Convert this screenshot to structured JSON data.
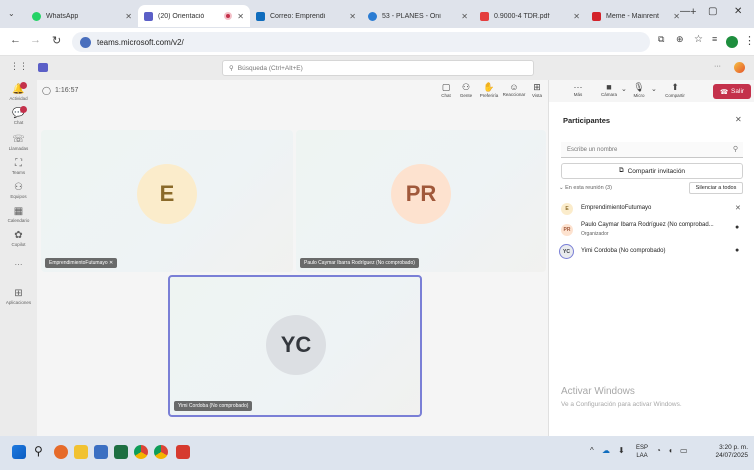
{
  "browser": {
    "tabs": [
      {
        "title": "WhatsApp",
        "color": "#25d366",
        "active": false
      },
      {
        "title": "(20) Orientació",
        "color": "#5b5fc7",
        "active": true,
        "recording": true
      },
      {
        "title": "Correo: Emprendi",
        "color": "#0f6cbd",
        "active": false
      },
      {
        "title": "53 - PLANES - Oni",
        "color": "#2b7cd3",
        "active": false
      },
      {
        "title": "0.9000-4 TDR.pdf",
        "color": "#e43d3d",
        "active": false
      },
      {
        "title": "Meme - Mainrent",
        "color": "#d3222a",
        "active": false
      }
    ],
    "new_tab": "+",
    "url": "teams.microsoft.com/v2/"
  },
  "teams_header": {
    "search_placeholder": "Búsqueda (Ctrl+Alt+E)",
    "more": "···"
  },
  "rail": [
    {
      "label": "Actividad",
      "icon": "bell-icon",
      "glyph": "🔔",
      "badge": true
    },
    {
      "label": "Chat",
      "icon": "chat-icon",
      "glyph": "💬",
      "badge": true
    },
    {
      "label": "Llamadas",
      "icon": "phone-icon",
      "glyph": "☏",
      "badge": false
    },
    {
      "label": "Teams",
      "icon": "teams-icon",
      "glyph": "⛶",
      "badge": false
    },
    {
      "label": "Equipos",
      "icon": "people-icon",
      "glyph": "⚇",
      "badge": false
    },
    {
      "label": "Calendario",
      "icon": "calendar-icon",
      "glyph": "▦",
      "badge": false
    },
    {
      "label": "Copilot",
      "icon": "copilot-icon",
      "glyph": "✿",
      "badge": false
    },
    {
      "label": "···",
      "icon": "more-icon",
      "glyph": "",
      "badge": false
    },
    {
      "label": "Aplicaciones",
      "icon": "apps-icon",
      "glyph": "⊞",
      "badge": false
    }
  ],
  "meeting": {
    "timer": "1:16:57",
    "tools": [
      {
        "label": "Chat",
        "glyph": "▢"
      },
      {
        "label": "Gente",
        "glyph": "⚇"
      },
      {
        "label": "Preferiría",
        "glyph": "✋"
      },
      {
        "label": "Reaccionar",
        "glyph": "☺"
      },
      {
        "label": "Vista",
        "glyph": "⊞"
      },
      {
        "label": "Más",
        "glyph": "···"
      },
      {
        "label": "Cámara",
        "glyph": "■"
      },
      {
        "label": "Micro",
        "glyph": "🎙"
      },
      {
        "label": "Compartir",
        "glyph": "⬆"
      }
    ],
    "leave": "Salir",
    "tiles": [
      {
        "initials": "E",
        "name": "EmprendimientoFutumayo",
        "bg": "#fbeccb",
        "fg": "#8a6a2a"
      },
      {
        "initials": "PR",
        "name": "Paulo Caymar Ibarra Rodríguez (No comprobado)",
        "bg": "#fde2cf",
        "fg": "#a0583a"
      },
      {
        "initials": "YC",
        "name": "Yimi Cordoba (No comprobado)",
        "bg": "#dcdfe3",
        "fg": "#33373d"
      }
    ]
  },
  "participants": {
    "title": "Participantes",
    "search_placeholder": "Escribe un nombre",
    "invite": "Compartir invitación",
    "section": "En esta reunión (3)",
    "mute_all": "Silenciar a todos",
    "people": [
      {
        "initials": "E",
        "name": "EmprendimientoFutumayo",
        "role": "",
        "bg": "#fbeccb",
        "fg": "#8a6a2a",
        "mic": "muted"
      },
      {
        "initials": "PR",
        "name": "Paulo Caymar Ibarra Rodríguez (No comprobad...",
        "role": "Organizador",
        "bg": "#fde2cf",
        "fg": "#a0583a",
        "mic": "on"
      },
      {
        "initials": "YC",
        "name": "Yimi Cordoba (No comprobado)",
        "role": "",
        "bg": "#e9ebee",
        "fg": "#33373d",
        "mic": "on"
      }
    ]
  },
  "watermark": {
    "title": "Activar Windows",
    "subtitle": "Ve a Configuración para activar Windows."
  },
  "taskbar": {
    "lang": "ESP",
    "lang2": "LAA",
    "time": "3:20 p. m.",
    "date": "24/07/2025"
  }
}
